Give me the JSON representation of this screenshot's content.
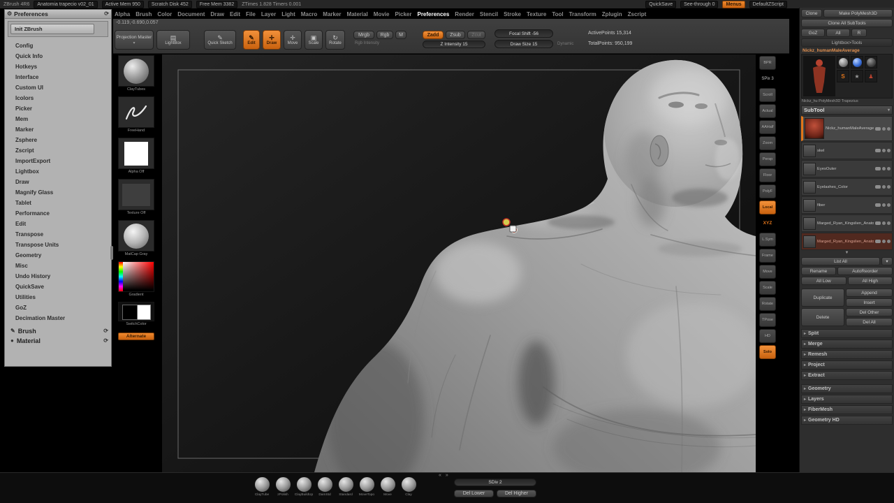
{
  "colors": {
    "accent": "#e2761b"
  },
  "titlebar": {
    "app": "ZBrush 4R6",
    "doc": "Anatomia trapecio v02_01",
    "active_mem": "Active Mem 950",
    "scratch_disk": "Scratch Disk 452",
    "free_mem": "Free Mem 3382",
    "ztimer": "ZTimes 1.828 Timers 0.001",
    "quicksave": "QuickSave",
    "see_through": "See-through 0",
    "menus": "Menus",
    "zscript": "DefaultZScript"
  },
  "menubar": {
    "items": [
      {
        "label": "Alpha"
      },
      {
        "label": "Brush"
      },
      {
        "label": "Color"
      },
      {
        "label": "Document"
      },
      {
        "label": "Draw"
      },
      {
        "label": "Edit"
      },
      {
        "label": "File"
      },
      {
        "label": "Layer"
      },
      {
        "label": "Light"
      },
      {
        "label": "Macro"
      },
      {
        "label": "Marker"
      },
      {
        "label": "Material"
      },
      {
        "label": "Movie"
      },
      {
        "label": "Picker"
      },
      {
        "label": "Preferences",
        "cls": "active"
      },
      {
        "label": "Render"
      },
      {
        "label": "Stencil"
      },
      {
        "label": "Stroke"
      },
      {
        "label": "Texture"
      },
      {
        "label": "Tool"
      },
      {
        "label": "Transform"
      },
      {
        "label": "Zplugin"
      },
      {
        "label": "Zscript"
      }
    ]
  },
  "toolbar": {
    "coords": "-0.119,-0.690,0.057",
    "projection_master": "Projection Master",
    "lightbox": "LightBox",
    "quick_sketch": "Quick Sketch",
    "edit": "Edit",
    "draw": "Draw",
    "move": "Move",
    "scale": "Scale",
    "rotate": "Rotate",
    "mrgb": "Mrgb",
    "rgb": "Rgb",
    "m": "M",
    "rgb_intensity": "Rgb Intensity",
    "zadd": "Zadd",
    "zsub": "Zsub",
    "zcut": "Zcut",
    "z_intensity": "Z Intensity 15",
    "focal_shift": "Focal Shift -56",
    "draw_size": "Draw Size 15",
    "dynamic": "Dynamic",
    "active_points": "ActivePoints 15,314",
    "total_points": "TotalPoints: 950,199"
  },
  "preferences": {
    "title": "Preferences",
    "init_button": "Init ZBrush",
    "items": [
      "Config",
      "Quick Info",
      "Hotkeys",
      "Interface",
      "Custom UI",
      "Icolors",
      "Picker",
      "Mem",
      "Marker",
      "Zsphere",
      "Zscript",
      "ImportExport",
      "Lightbox",
      "Draw",
      "Magnify Glass",
      "Tablet",
      "Performance",
      "Edit",
      "Transpose",
      "Transpose Units",
      "Geometry",
      "Misc",
      "Undo History",
      "QuickSave",
      "Utilities",
      "GoZ",
      "Decimation Master"
    ],
    "brush": "Brush",
    "material": "Material"
  },
  "left_tools": {
    "brush_label": "ClayTubes",
    "stroke_label": "FreeHand",
    "alpha_label": "Alpha Off",
    "texture_label": "Texture Off",
    "material_label": "MatCap Gray",
    "gradient_label": "Gradient",
    "switch_label": "SwitchColor",
    "alternate_label": "Alternate"
  },
  "shelf": {
    "items": [
      {
        "label": "BPR"
      },
      {
        "label": "SPix 3",
        "cls": "bare"
      },
      {
        "label": "Scroll"
      },
      {
        "label": "Actual"
      },
      {
        "label": "AAHalf"
      },
      {
        "label": "Zoom"
      },
      {
        "label": "Persp"
      },
      {
        "label": "Floor"
      },
      {
        "label": "PolyF"
      },
      {
        "label": "Local",
        "cls": "accent"
      },
      {
        "label": "XYZ",
        "cls": "accent-text"
      },
      {
        "label": "L.Sym"
      },
      {
        "label": "Frame"
      },
      {
        "label": "Move"
      },
      {
        "label": "Scale"
      },
      {
        "label": "Rotate"
      },
      {
        "label": "TPose"
      },
      {
        "label": "HD"
      },
      {
        "label": "Solo",
        "cls": "accent"
      }
    ]
  },
  "tool_panel": {
    "clone": "Clone",
    "make_polymesh": "Make PolyMesh3D",
    "clone_all": "Clone All SubTools",
    "goz": "GoZ",
    "goz_all": "All",
    "r": "R",
    "lightbox_tools": "Lightbox>Tools",
    "tool_name": "Nickz_humanMaleAverage",
    "caption": "Nickz_hu PolyMesh3D Trapezius"
  },
  "subtool": {
    "header": "SubTool",
    "items": [
      {
        "label": "Nickz_humanMaleAverage_",
        "cls": "selected"
      },
      {
        "label": "skel"
      },
      {
        "label": "EyesOuter"
      },
      {
        "label": "Eyelashes_Color"
      },
      {
        "label": "fiber"
      },
      {
        "label": "Marged_Ryan_Kingslien_Anatomy_"
      },
      {
        "label": "Marged_Ryan_Kingslien_Anatomy_",
        "cls": "alt"
      }
    ],
    "list_all": "List All",
    "rename": "Rename",
    "autoreorder": "AutoReorder",
    "all_low": "All Low",
    "all_high": "All High",
    "duplicate": "Duplicate",
    "append": "Append",
    "insert": "Insert",
    "del": "Delete",
    "del_other": "Del Other",
    "del_all": "Del All",
    "sections": [
      "Split",
      "Merge",
      "Remesh",
      "Project",
      "Extract"
    ],
    "palettes": [
      "Geometry",
      "Layers",
      "FiberMesh",
      "Geometry HD"
    ]
  },
  "bottombar": {
    "brushes": [
      "ClayTube",
      "zPolish",
      "ClayBuildUp",
      "DamStd",
      "Standard",
      "MoveTopo",
      "Move",
      "Clay"
    ],
    "sdiv": "SDiv 2",
    "del_lower": "Del Lower",
    "del_higher": "Del Higher"
  }
}
